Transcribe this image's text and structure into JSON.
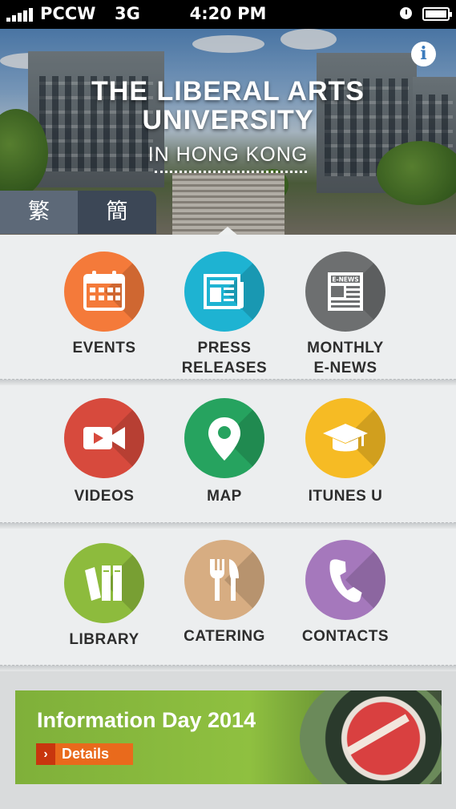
{
  "status_bar": {
    "carrier": "PCCW",
    "network": "3G",
    "time": "4:20 PM"
  },
  "header": {
    "title_line1": "THE LIBERAL ARTS",
    "title_line2": "UNIVERSITY",
    "subtitle": "IN HONG KONG",
    "info_glyph": "i",
    "languages": {
      "traditional": "繁",
      "simplified": "簡"
    }
  },
  "menu": [
    {
      "label": "EVENTS",
      "color": "#f47a3a",
      "icon": "calendar-icon"
    },
    {
      "label": "PRESS\nRELEASES",
      "color": "#1eb3d2",
      "icon": "newspaper-icon"
    },
    {
      "label": "MONTHLY\nE-NEWS",
      "color": "#6d6f70",
      "icon": "e-news-icon",
      "icon_text": "E-NEWS"
    },
    {
      "label": "VIDEOS",
      "color": "#d74a3d",
      "icon": "video-camera-icon"
    },
    {
      "label": "MAP",
      "color": "#26a35f",
      "icon": "map-pin-icon"
    },
    {
      "label": "ITUNES U",
      "color": "#f6bb24",
      "icon": "graduation-cap-icon"
    },
    {
      "label": "LIBRARY",
      "color": "#8dbb3d",
      "icon": "books-icon"
    },
    {
      "label": "CATERING",
      "color": "#d7ad82",
      "icon": "fork-knife-icon"
    },
    {
      "label": "CONTACTS",
      "color": "#a578bc",
      "icon": "phone-icon"
    }
  ],
  "banner": {
    "title": "Information Day 2014",
    "button_label": "Details",
    "chevron": "›"
  }
}
